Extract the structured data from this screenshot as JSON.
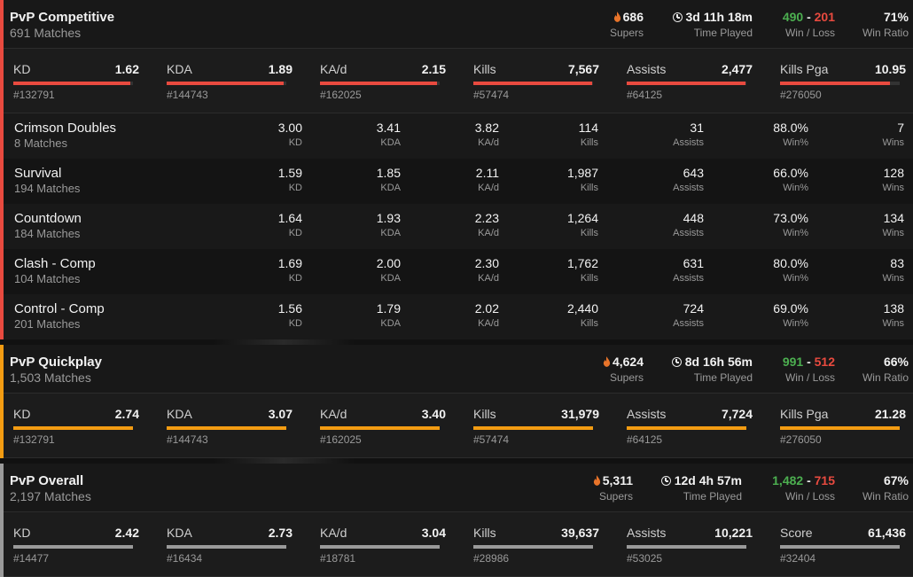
{
  "colors": {
    "competitive": "#e84a3f",
    "quickplay": "#f39c12",
    "overall": "#9a9a9a",
    "win": "#4caf50",
    "loss": "#e84a3f"
  },
  "competitive": {
    "title": "PvP Competitive",
    "matches": "691 Matches",
    "supers": {
      "value": "686",
      "label": "Supers",
      "icon": "flame-icon"
    },
    "time": {
      "value": "3d 11h 18m",
      "label": "Time Played",
      "icon": "clock-icon"
    },
    "winloss": {
      "wins": "490",
      "sep": " - ",
      "losses": "201",
      "label": "Win / Loss"
    },
    "winratio": {
      "value": "71%",
      "label": "Win Ratio"
    },
    "stats": [
      {
        "label": "KD",
        "value": "1.62",
        "rank": "#132791",
        "fill": 0.98
      },
      {
        "label": "KDA",
        "value": "1.89",
        "rank": "#144743",
        "fill": 0.98
      },
      {
        "label": "KA/d",
        "value": "2.15",
        "rank": "#162025",
        "fill": 0.98
      },
      {
        "label": "Kills",
        "value": "7,567",
        "rank": "#57474",
        "fill": 0.99
      },
      {
        "label": "Assists",
        "value": "2,477",
        "rank": "#64125",
        "fill": 0.99
      },
      {
        "label": "Kills Pga",
        "value": "10.95",
        "rank": "#276050",
        "fill": 0.92
      }
    ],
    "modes": [
      {
        "name": "Crimson Doubles",
        "matches": "8 Matches",
        "kd": "3.00",
        "kda": "3.41",
        "kad": "3.82",
        "kills": "114",
        "assists": "31",
        "winpct": "88.0%",
        "wins": "7"
      },
      {
        "name": "Survival",
        "matches": "194 Matches",
        "kd": "1.59",
        "kda": "1.85",
        "kad": "2.11",
        "kills": "1,987",
        "assists": "643",
        "winpct": "66.0%",
        "wins": "128"
      },
      {
        "name": "Countdown",
        "matches": "184 Matches",
        "kd": "1.64",
        "kda": "1.93",
        "kad": "2.23",
        "kills": "1,264",
        "assists": "448",
        "winpct": "73.0%",
        "wins": "134"
      },
      {
        "name": "Clash - Comp",
        "matches": "104 Matches",
        "kd": "1.69",
        "kda": "2.00",
        "kad": "2.30",
        "kills": "1,762",
        "assists": "631",
        "winpct": "80.0%",
        "wins": "83"
      },
      {
        "name": "Control - Comp",
        "matches": "201 Matches",
        "kd": "1.56",
        "kda": "1.79",
        "kad": "2.02",
        "kills": "2,440",
        "assists": "724",
        "winpct": "69.0%",
        "wins": "138"
      }
    ],
    "mode_labels": {
      "kd": "KD",
      "kda": "KDA",
      "kad": "KA/d",
      "kills": "Kills",
      "assists": "Assists",
      "winpct": "Win%",
      "wins": "Wins"
    }
  },
  "quickplay": {
    "title": "PvP Quickplay",
    "matches": "1,503 Matches",
    "supers": {
      "value": "4,624",
      "label": "Supers",
      "icon": "flame-icon"
    },
    "time": {
      "value": "8d 16h 56m",
      "label": "Time Played",
      "icon": "clock-icon"
    },
    "winloss": {
      "wins": "991",
      "sep": " - ",
      "losses": "512",
      "label": "Win / Loss"
    },
    "winratio": {
      "value": "66%",
      "label": "Win Ratio"
    },
    "stats": [
      {
        "label": "KD",
        "value": "2.74",
        "rank": "#132791",
        "fill": 1.0
      },
      {
        "label": "KDA",
        "value": "3.07",
        "rank": "#144743",
        "fill": 1.0
      },
      {
        "label": "KA/d",
        "value": "3.40",
        "rank": "#162025",
        "fill": 1.0
      },
      {
        "label": "Kills",
        "value": "31,979",
        "rank": "#57474",
        "fill": 1.0
      },
      {
        "label": "Assists",
        "value": "7,724",
        "rank": "#64125",
        "fill": 1.0
      },
      {
        "label": "Kills Pga",
        "value": "21.28",
        "rank": "#276050",
        "fill": 1.0
      }
    ]
  },
  "overall": {
    "title": "PvP Overall",
    "matches": "2,197 Matches",
    "supers": {
      "value": "5,311",
      "label": "Supers",
      "icon": "flame-icon"
    },
    "time": {
      "value": "12d 4h 57m",
      "label": "Time Played",
      "icon": "clock-icon"
    },
    "winloss": {
      "wins": "1,482",
      "sep": " - ",
      "losses": "715",
      "label": "Win / Loss"
    },
    "winratio": {
      "value": "67%",
      "label": "Win Ratio"
    },
    "stats": [
      {
        "label": "KD",
        "value": "2.42",
        "rank": "#14477",
        "fill": 1.0
      },
      {
        "label": "KDA",
        "value": "2.73",
        "rank": "#16434",
        "fill": 1.0
      },
      {
        "label": "KA/d",
        "value": "3.04",
        "rank": "#18781",
        "fill": 1.0
      },
      {
        "label": "Kills",
        "value": "39,637",
        "rank": "#28986",
        "fill": 1.0
      },
      {
        "label": "Assists",
        "value": "10,221",
        "rank": "#53025",
        "fill": 1.0
      },
      {
        "label": "Score",
        "value": "61,436",
        "rank": "#32404",
        "fill": 1.0
      }
    ]
  }
}
